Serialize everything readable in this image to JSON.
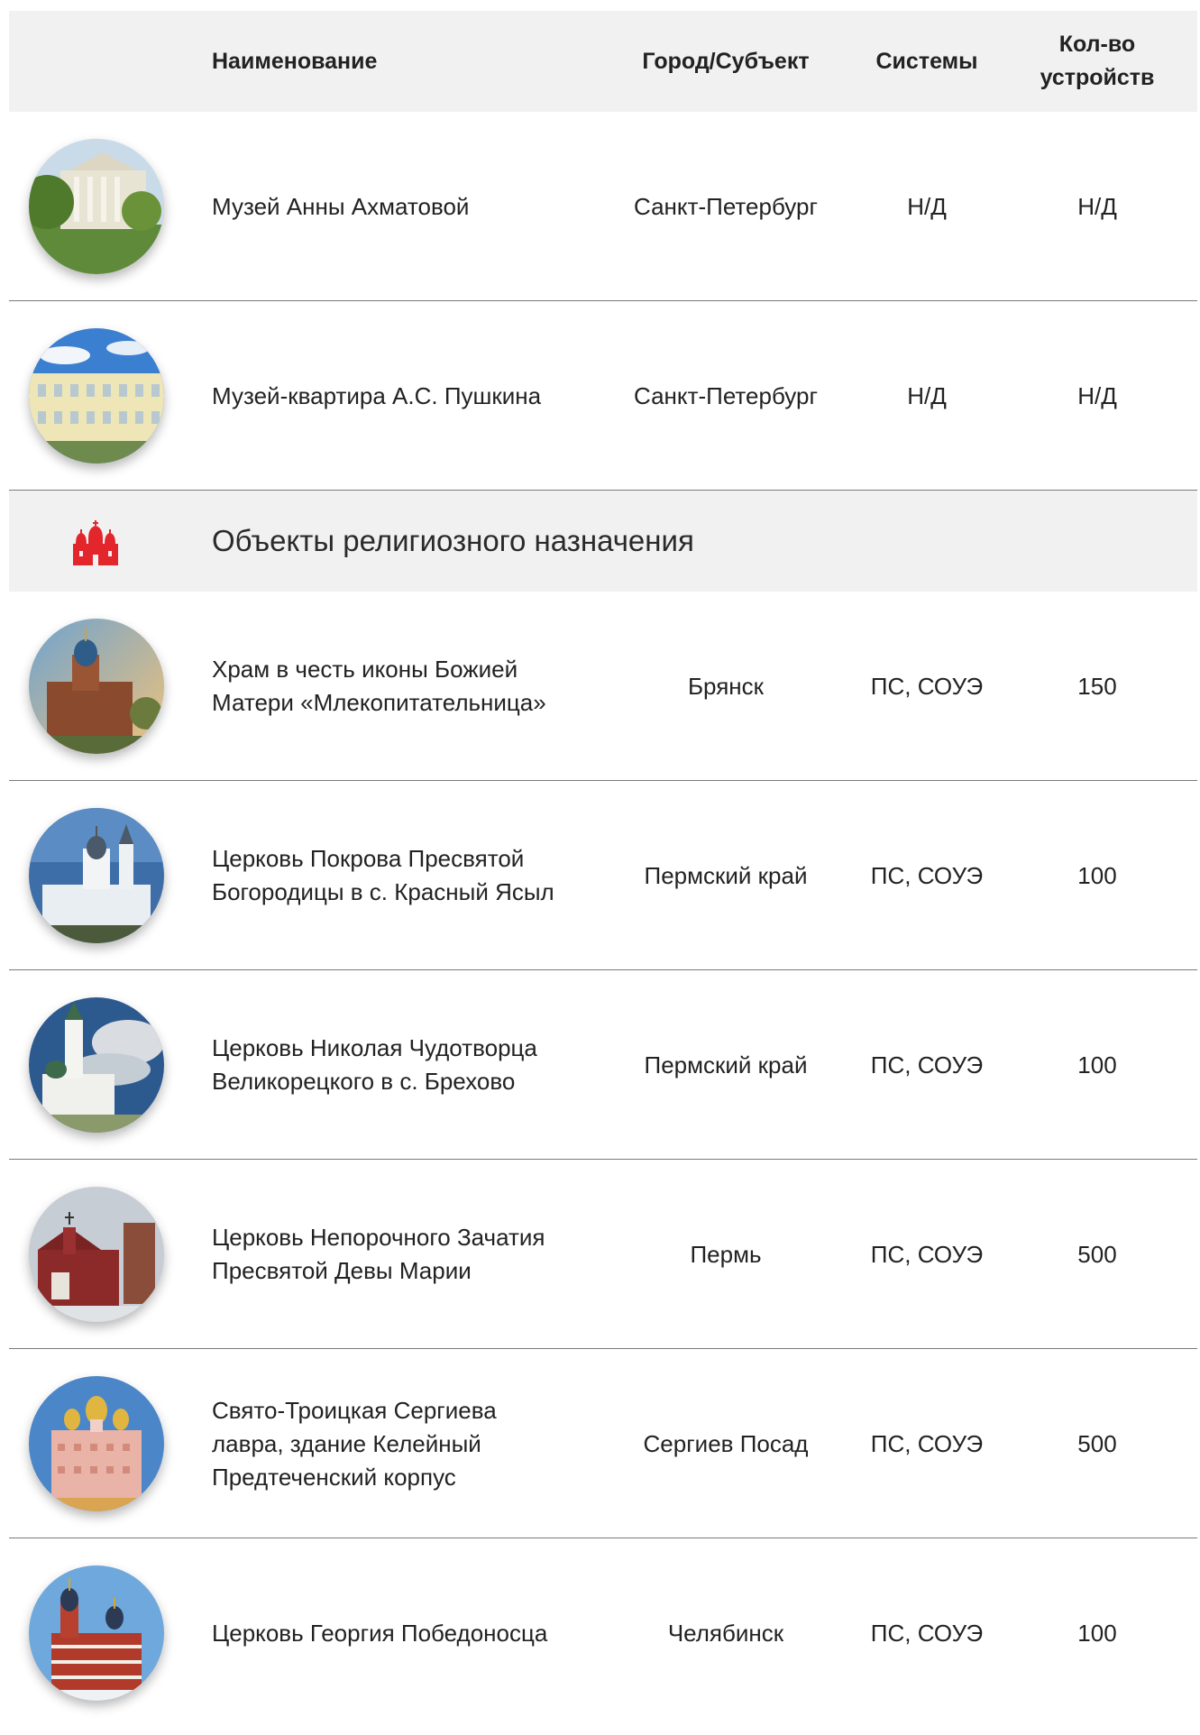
{
  "accent_color": "#e3262b",
  "header": {
    "name": "Наименование",
    "city": "Город/Субъект",
    "systems": "Системы",
    "count": "Кол-во\nустройств"
  },
  "museums": [
    {
      "name": "Музей Анны Ахматовой",
      "city": "Санкт-Петербург",
      "systems": "Н/Д",
      "count": "Н/Д",
      "photo": "museum-building-photo"
    },
    {
      "name": "Музей-квартира А.С. Пушкина",
      "city": "Санкт-Петербург",
      "systems": "Н/Д",
      "count": "Н/Д",
      "photo": "mansion-photo"
    }
  ],
  "section": {
    "title": "Объекты религиозного назначения",
    "icon": "church-icon"
  },
  "religious": [
    {
      "name": "Храм в честь иконы Божией\nМатери «Млекопитательница»",
      "city": "Брянск",
      "systems": "ПС, СОУЭ",
      "count": "150"
    },
    {
      "name": "Церковь Покрова Пресвятой\nБогородицы в с. Красный Ясыл",
      "city": "Пермский край",
      "systems": "ПС, СОУЭ",
      "count": "100"
    },
    {
      "name": "Церковь Николая Чудотворца\nВеликорецкого в с. Брехово",
      "city": "Пермский край",
      "systems": "ПС, СОУЭ",
      "count": "100"
    },
    {
      "name": "Церковь Непорочного Зачатия\nПресвятой Девы Марии",
      "city": "Пермь",
      "systems": "ПС, СОУЭ",
      "count": "500"
    },
    {
      "name": "Свято-Троицкая Сергиева\nлавра, здание Келейный\nПредтеченский корпус",
      "city": "Сергиев Посад",
      "systems": "ПС, СОУЭ",
      "count": "500"
    },
    {
      "name": "Церковь Георгия Победоносца",
      "city": "Челябинск",
      "systems": "ПС, СОУЭ",
      "count": "100"
    }
  ]
}
